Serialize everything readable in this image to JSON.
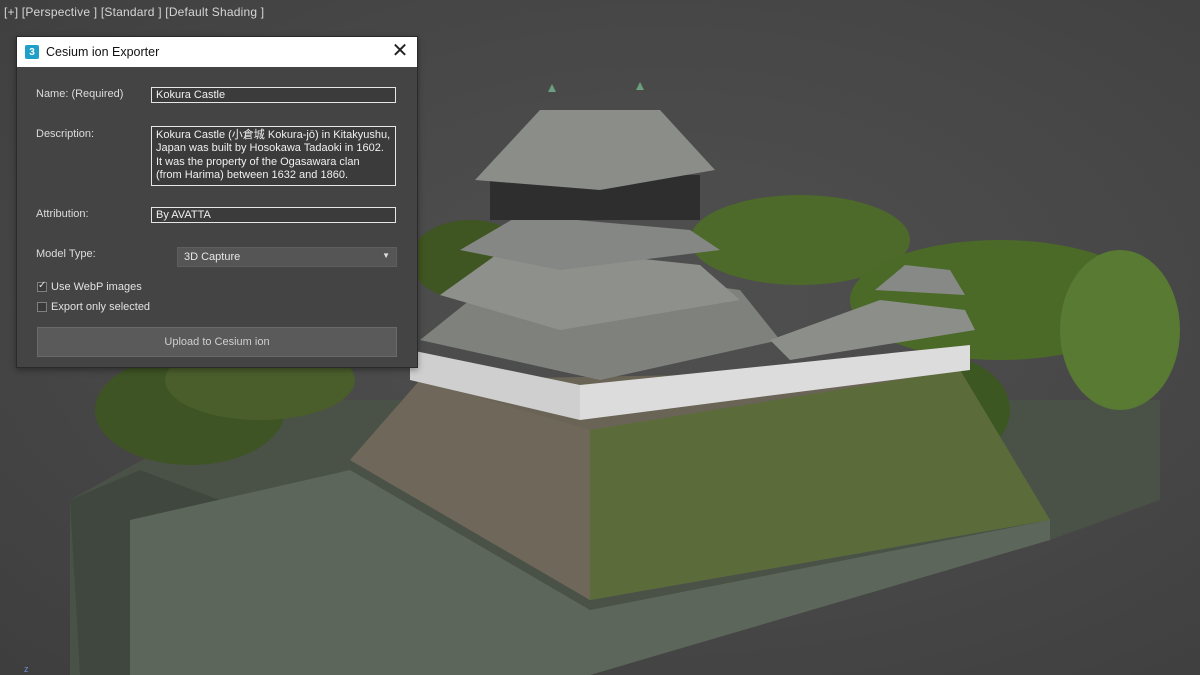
{
  "viewport": {
    "label": "[+] [Perspective ] [Standard ] [Default Shading ]",
    "axis_mark": "z"
  },
  "dialog": {
    "icon": "3",
    "title": "Cesium ion Exporter",
    "close_icon": "✕",
    "name_label": "Name: (Required)",
    "name_value": "Kokura Castle",
    "description_label": "Description:",
    "description_value": "Kokura Castle (小倉城 Kokura-jō) in Kitakyushu,\nJapan was built by Hosokawa Tadaoki in 1602.\nIt was the property of the Ogasawara clan\n(from Harima) between 1632 and 1860.",
    "attribution_label": "Attribution:",
    "attribution_value": "By AVATTA",
    "model_type_label": "Model Type:",
    "model_type_value": "3D Capture",
    "webp_label": "Use WebP images",
    "webp_checked": true,
    "export_selected_label": "Export only selected",
    "export_selected_checked": false,
    "upload_label": "Upload to Cesium ion"
  },
  "colors": {
    "viewport_bg": "#444444",
    "dialog_bg": "#444444",
    "titlebar_bg": "#ffffff",
    "foliage": "#4f6a2a",
    "stone": "#6b6558",
    "roof": "#8a8d88"
  }
}
